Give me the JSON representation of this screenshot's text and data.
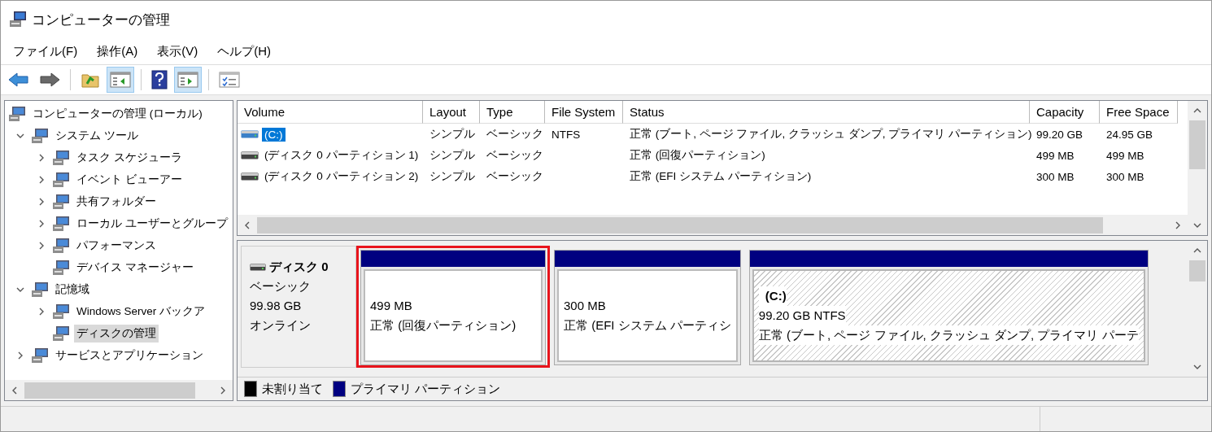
{
  "window": {
    "title": "コンピューターの管理"
  },
  "menu": [
    "ファイル(F)",
    "操作(A)",
    "表示(V)",
    "ヘルプ(H)"
  ],
  "toolbar": [
    {
      "disabled": false,
      "pressed": false
    },
    {
      "disabled": true,
      "pressed": false
    },
    {
      "disabled": false,
      "pressed": false
    },
    {
      "disabled": false,
      "pressed": true
    },
    {
      "disabled": false,
      "pressed": false
    },
    {
      "disabled": false,
      "pressed": true
    },
    {
      "disabled": false,
      "pressed": false
    }
  ],
  "tree": {
    "label": "コンピューターの管理 (ローカル)",
    "selected": false,
    "children": [
      {
        "label": "システム ツール",
        "expandable": true,
        "expanded": true,
        "selected": false,
        "children": [
          {
            "label": "タスク スケジューラ",
            "expandable": true,
            "expanded": false,
            "selected": false
          },
          {
            "label": "イベント ビューアー",
            "expandable": true,
            "expanded": false,
            "selected": false
          },
          {
            "label": "共有フォルダー",
            "expandable": true,
            "expanded": false,
            "selected": false
          },
          {
            "label": "ローカル ユーザーとグループ",
            "expandable": true,
            "expanded": false,
            "selected": false
          },
          {
            "label": "パフォーマンス",
            "expandable": true,
            "expanded": false,
            "selected": false
          },
          {
            "label": "デバイス マネージャー",
            "expandable": false,
            "selected": false
          }
        ]
      },
      {
        "label": "記憶域",
        "expandable": true,
        "expanded": true,
        "selected": false,
        "children": [
          {
            "label": "Windows Server バックア",
            "expandable": true,
            "expanded": false,
            "selected": false
          },
          {
            "label": "ディスクの管理",
            "expandable": false,
            "selected": true
          }
        ]
      },
      {
        "label": "サービスとアプリケーション",
        "expandable": true,
        "expanded": false,
        "selected": false
      }
    ]
  },
  "volumes": {
    "columns": [
      "Volume",
      "Layout",
      "Type",
      "File System",
      "Status",
      "Capacity",
      "Free Space"
    ],
    "rows": [
      {
        "volume": "(C:)",
        "layout": "シンプル",
        "type": "ベーシック",
        "file_system": "NTFS",
        "status": "正常 (ブート, ページ ファイル, クラッシュ ダンプ, プライマリ パーティション)",
        "capacity": "99.20 GB",
        "free_space": "24.95 GB",
        "selected": true
      },
      {
        "volume": "(ディスク 0 パーティション 1)",
        "layout": "シンプル",
        "type": "ベーシック",
        "status": "正常 (回復パーティション)",
        "capacity": "499 MB",
        "free_space": "499 MB",
        "selected": false
      },
      {
        "volume": "(ディスク 0 パーティション 2)",
        "layout": "シンプル",
        "type": "ベーシック",
        "status": "正常 (EFI システム パーティション)",
        "capacity": "300 MB",
        "free_space": "300 MB",
        "selected": false
      }
    ]
  },
  "disks": [
    {
      "name": "ディスク 0",
      "type": "ベーシック",
      "size": "99.98 GB",
      "state": "オンライン",
      "partitions": [
        {
          "size": "499 MB",
          "status": "正常 (回復パーティション)",
          "hatched": false,
          "highlighted": true
        },
        {
          "size": "300 MB",
          "status": "正常 (EFI システム パーティシ",
          "hatched": false,
          "highlighted": false
        },
        {
          "label": "(C:)",
          "size": "99.20 GB NTFS",
          "status": "正常 (ブート, ページ ファイル, クラッシュ ダンプ, プライマリ パーテ",
          "hatched": true,
          "highlighted": false
        }
      ]
    }
  ],
  "legend": [
    {
      "label": "未割り当て",
      "color": "#000000"
    },
    {
      "label": "プライマリ パーティション",
      "color": "#000080"
    }
  ]
}
